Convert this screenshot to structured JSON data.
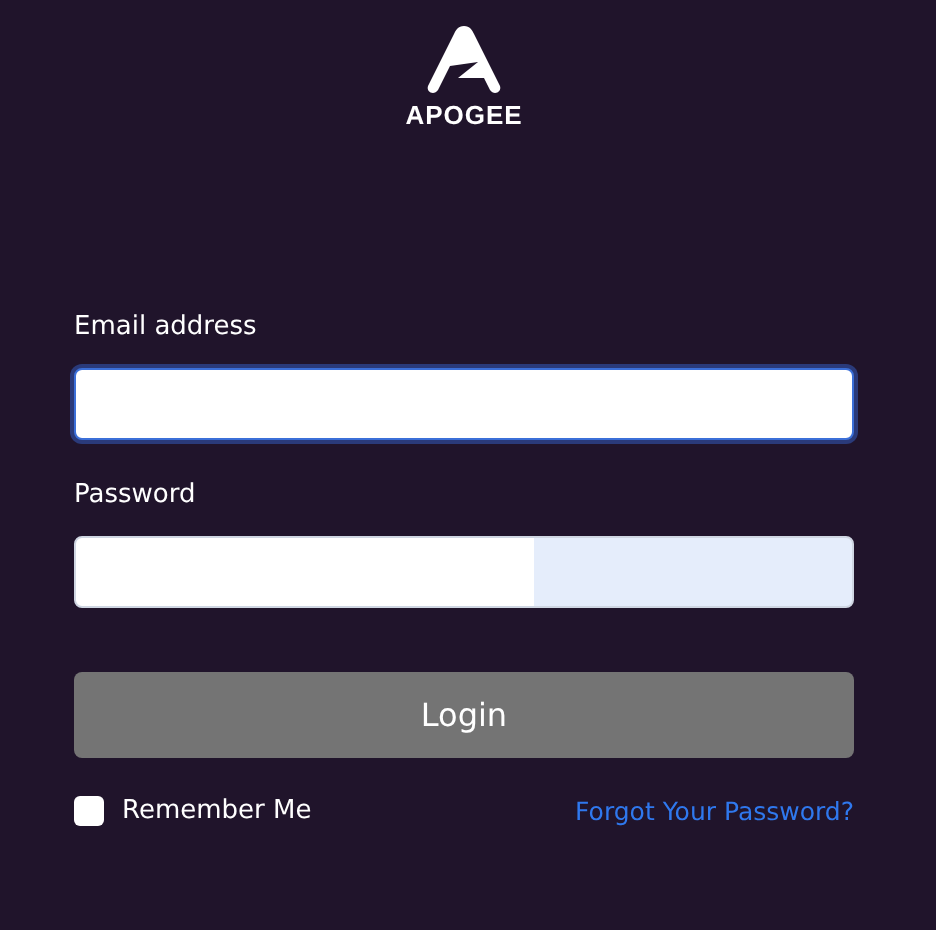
{
  "logo": {
    "text": "APOGEE"
  },
  "fields": [
    {
      "label": "Email address",
      "focused": true,
      "autofilled": false
    },
    {
      "label": "Password",
      "focused": false,
      "autofilled": true
    }
  ],
  "login_button": {
    "label": "Login"
  },
  "remember_me": {
    "label": "Remember Me",
    "checked": false
  },
  "forgot_link": {
    "label": "Forgot Your Password?"
  }
}
